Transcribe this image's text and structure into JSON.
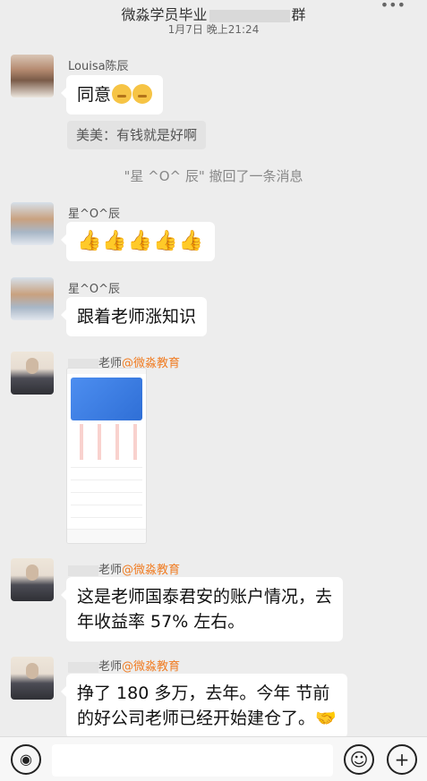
{
  "header": {
    "title_left": "微淼学员毕业",
    "title_right": "群",
    "subtitle": "1月7日 晚上21:24",
    "more_icon": "more-dots-icon"
  },
  "messages": {
    "m1": {
      "name": "Louisa陈辰",
      "text": "同意"
    },
    "quote": "美美：有钱就是好啊",
    "system": "\"星 ^O^ 辰\" 撤回了一条消息",
    "m2": {
      "name": "星^O^辰",
      "text": "👍👍👍👍👍"
    },
    "m3": {
      "name": "星^O^辰",
      "text": "跟着老师涨知识"
    },
    "t1": {
      "name_role": "老师",
      "name_org": "@微淼教育"
    },
    "t2": {
      "name_role": "老师",
      "name_org": "@微淼教育",
      "line1": "这是老师国泰君安的账户情况，去",
      "line2": "年收益率 57% 左右。"
    },
    "t3": {
      "name_role": "老师",
      "name_org": "@微淼教育",
      "line1": "挣了 180 多万，去年。今年 节前",
      "line2": "的好公司老师已经开始建仓了。🤝"
    }
  },
  "bottom_bar": {
    "voice_icon": "voice-icon",
    "emoji_icon": "emoji-icon",
    "plus_icon": "plus-icon"
  }
}
